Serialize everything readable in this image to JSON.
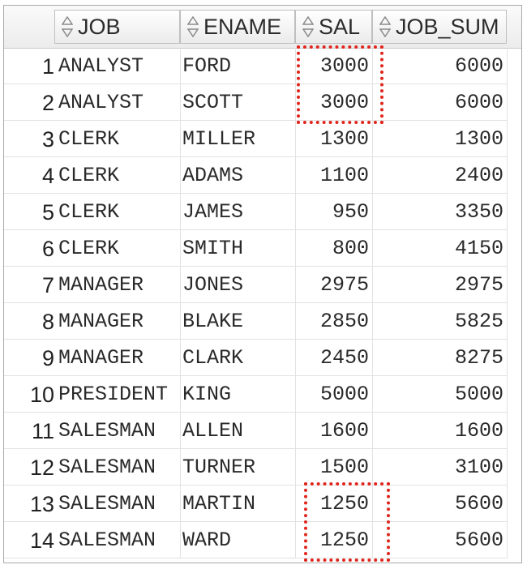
{
  "columns": {
    "job": "JOB",
    "ename": "ENAME",
    "sal": "SAL",
    "job_sum": "JOB_SUM"
  },
  "rows": [
    {
      "num": "1",
      "job": "ANALYST",
      "ename": "FORD",
      "sal": "3000",
      "job_sum": "6000"
    },
    {
      "num": "2",
      "job": "ANALYST",
      "ename": "SCOTT",
      "sal": "3000",
      "job_sum": "6000"
    },
    {
      "num": "3",
      "job": "CLERK",
      "ename": "MILLER",
      "sal": "1300",
      "job_sum": "1300"
    },
    {
      "num": "4",
      "job": "CLERK",
      "ename": "ADAMS",
      "sal": "1100",
      "job_sum": "2400"
    },
    {
      "num": "5",
      "job": "CLERK",
      "ename": "JAMES",
      "sal": "950",
      "job_sum": "3350"
    },
    {
      "num": "6",
      "job": "CLERK",
      "ename": "SMITH",
      "sal": "800",
      "job_sum": "4150"
    },
    {
      "num": "7",
      "job": "MANAGER",
      "ename": "JONES",
      "sal": "2975",
      "job_sum": "2975"
    },
    {
      "num": "8",
      "job": "MANAGER",
      "ename": "BLAKE",
      "sal": "2850",
      "job_sum": "5825"
    },
    {
      "num": "9",
      "job": "MANAGER",
      "ename": "CLARK",
      "sal": "2450",
      "job_sum": "8275"
    },
    {
      "num": "10",
      "job": "PRESIDENT",
      "ename": "KING",
      "sal": "5000",
      "job_sum": "5000"
    },
    {
      "num": "11",
      "job": "SALESMAN",
      "ename": "ALLEN",
      "sal": "1600",
      "job_sum": "1600"
    },
    {
      "num": "12",
      "job": "SALESMAN",
      "ename": "TURNER",
      "sal": "1500",
      "job_sum": "3100"
    },
    {
      "num": "13",
      "job": "SALESMAN",
      "ename": "MARTIN",
      "sal": "1250",
      "job_sum": "5600"
    },
    {
      "num": "14",
      "job": "SALESMAN",
      "ename": "WARD",
      "sal": "1250",
      "job_sum": "5600"
    }
  ],
  "icons": {
    "sort": "sort-arrows-icon"
  },
  "colors": {
    "highlight": "#e0251d",
    "header_bg": "#ececec",
    "grid_line": "#e2e2e2"
  }
}
